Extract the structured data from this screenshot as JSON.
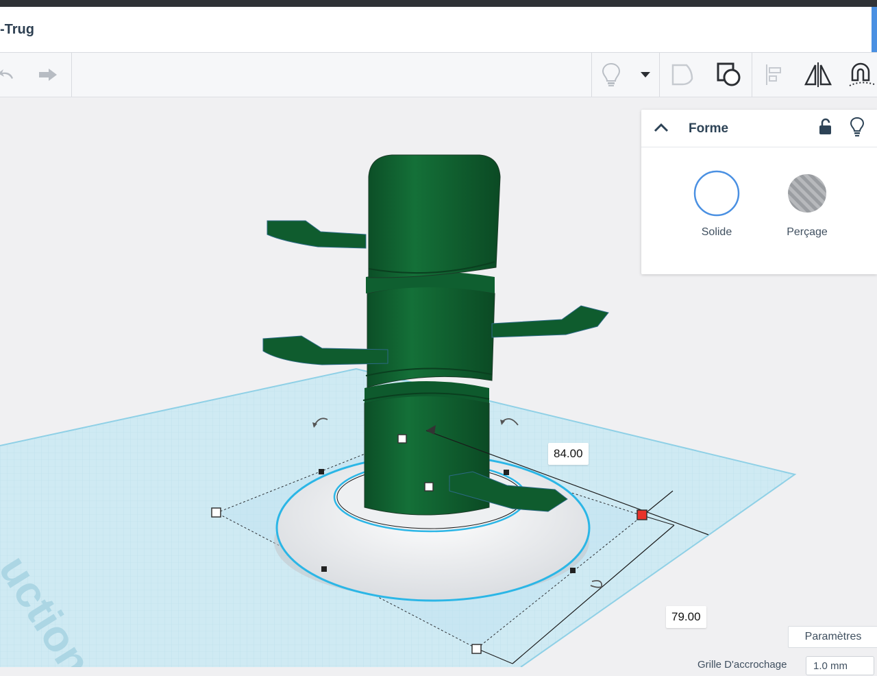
{
  "window": {
    "title": "-Trug"
  },
  "toolbar": {
    "undo_icon": "undo-icon",
    "redo_icon": "redo-icon",
    "hint_icon": "lightbulb-icon",
    "dropdown_icon": "caret-down-icon",
    "group_icon": "group-icon",
    "ungroup_icon": "ungroup-icon",
    "align_icon": "align-icon",
    "mirror_icon": "mirror-icon",
    "magnet_icon": "magnet-icon"
  },
  "shape_panel": {
    "title": "Forme",
    "options": [
      {
        "label": "Solide"
      },
      {
        "label": "Perçage"
      }
    ]
  },
  "workplane": {
    "watermark": "uction",
    "dimension_width": "84.00",
    "dimension_depth": "79.00"
  },
  "footer": {
    "params_label": "Paramètres",
    "grid_label": "Grille D'accrochage",
    "grid_value": "1.0 mm"
  },
  "colors": {
    "shape_green": "#0f5c2e",
    "selection_blue": "#2bb6e6",
    "handle_red": "#e8332a",
    "accent_blue": "#4a90e2"
  }
}
